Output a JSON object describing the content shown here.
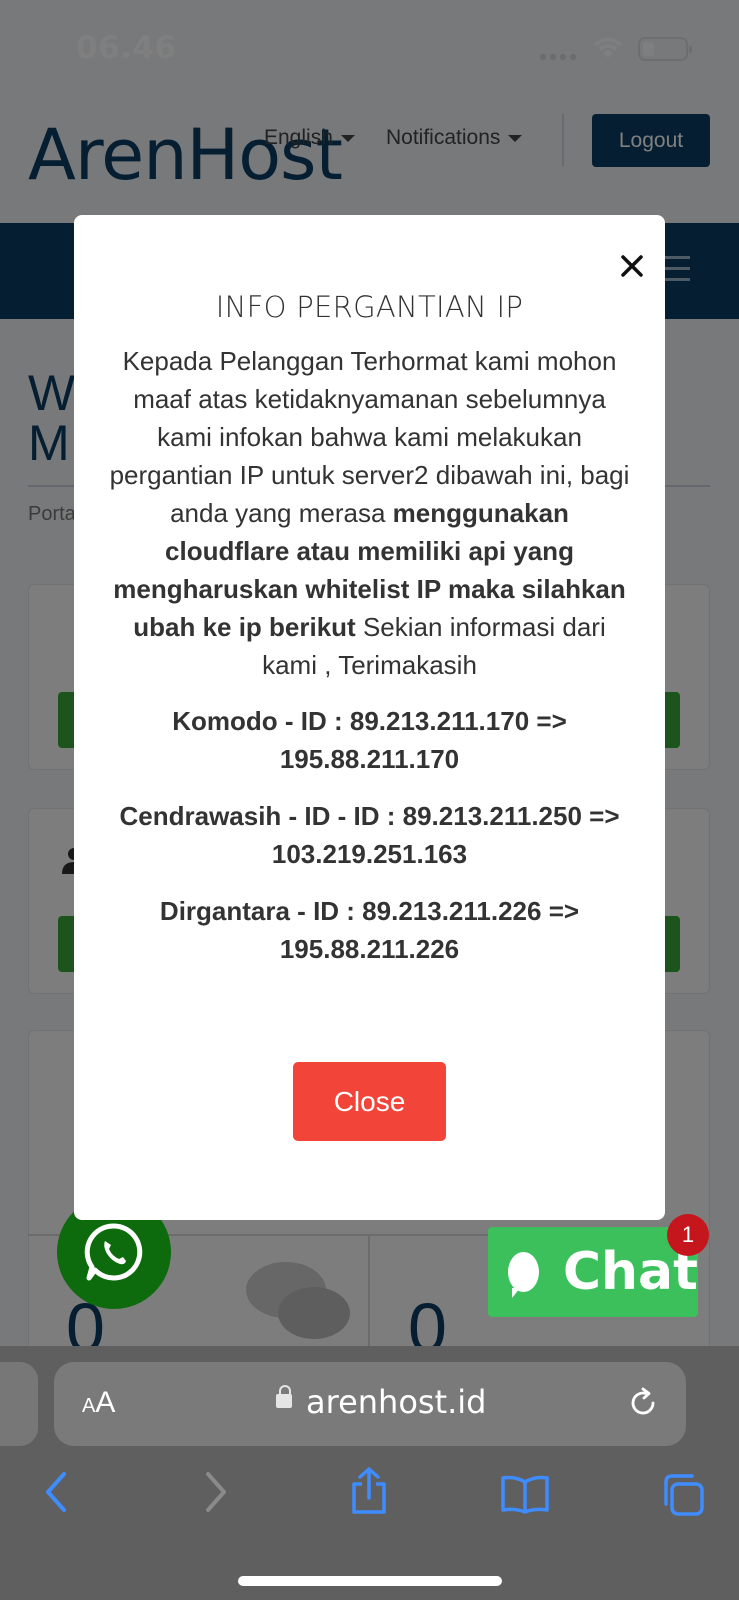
{
  "status_bar": {
    "time": "06.46"
  },
  "site": {
    "logo": "ArenHost",
    "nav": {
      "language": "English",
      "notifications": "Notifications",
      "logout": "Logout"
    },
    "page_heading_partial": [
      "W",
      "M"
    ],
    "breadcrumb_partial": "Porta",
    "stats": [
      "0",
      "0"
    ]
  },
  "modal": {
    "title": "INFO PERGANTIAN IP",
    "body_intro": "Kepada Pelanggan Terhormat kami mohon maaf atas ketidaknyamanan sebelumnya kami infokan bahwa kami melakukan pergantian IP untuk server2 dibawah ini, bagi anda yang merasa",
    "body_bold": "menggunakan cloudflare atau memiliki api yang mengharuskan whitelist IP maka silahkan ubah ke ip berikut",
    "body_outro": "Sekian informasi dari kami , Terimakasih",
    "ip_changes": [
      "Komodo - ID : 89.213.211.170 => 195.88.211.170",
      "Cendrawasih - ID - ID : 89.213.211.250 => 103.219.251.163",
      "Dirgantara - ID : 89.213.211.226 => 195.88.211.226"
    ],
    "close_button": "Close"
  },
  "chat_widget": {
    "label": "Chat",
    "badge": "1"
  },
  "browser": {
    "aa_small": "A",
    "aa_large": "A",
    "url": "arenhost.id"
  },
  "colors": {
    "brand": "#0a3d62",
    "close_button": "#f3443a",
    "chat": "#3cc05b",
    "whatsapp": "#0d6b0d",
    "badge": "#c4161c"
  },
  "icons": [
    "wifi-icon",
    "battery-icon",
    "caret-down-icon",
    "hamburger-icon",
    "close-icon",
    "user-icon",
    "whatsapp-icon",
    "chat-icon",
    "lock-icon",
    "reload-icon",
    "back-icon",
    "forward-icon",
    "share-icon",
    "bookmarks-icon",
    "tabs-icon"
  ]
}
